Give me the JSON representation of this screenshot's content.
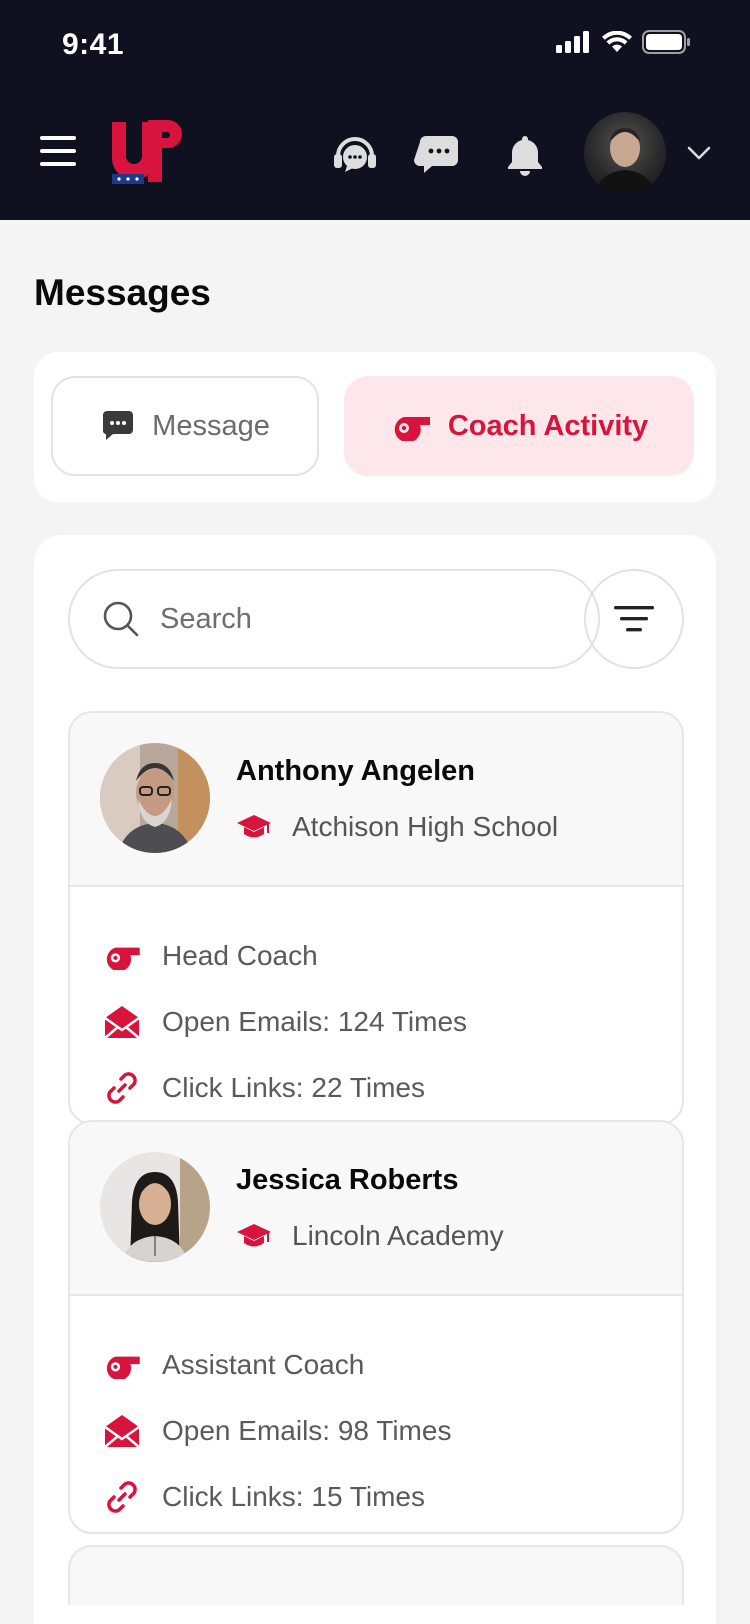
{
  "status_bar": {
    "time": "9:41"
  },
  "header": {
    "logo_text": "UP",
    "icons": [
      "menu-icon",
      "support-headset-icon",
      "chat-icon",
      "bell-icon",
      "chevron-down-icon"
    ]
  },
  "page": {
    "title": "Messages"
  },
  "tabs": [
    {
      "label": "Message",
      "icon": "chat-icon",
      "active": false
    },
    {
      "label": "Coach Activity",
      "icon": "whistle-icon",
      "active": true
    }
  ],
  "search": {
    "placeholder": "Search"
  },
  "colors": {
    "accent": "#d9143c",
    "accent_bg": "#fde7ea",
    "header_bg": "#0f1120"
  },
  "coaches": [
    {
      "name": "Anthony Angelen",
      "school": "Atchison High School",
      "role": "Head Coach",
      "open_emails": "Open Emails: 124 Times",
      "click_links": "Click Links: 22 Times"
    },
    {
      "name": "Jessica Roberts",
      "school": "Lincoln Academy",
      "role": "Assistant Coach",
      "open_emails": "Open Emails: 98 Times",
      "click_links": "Click Links: 15 Times"
    }
  ]
}
